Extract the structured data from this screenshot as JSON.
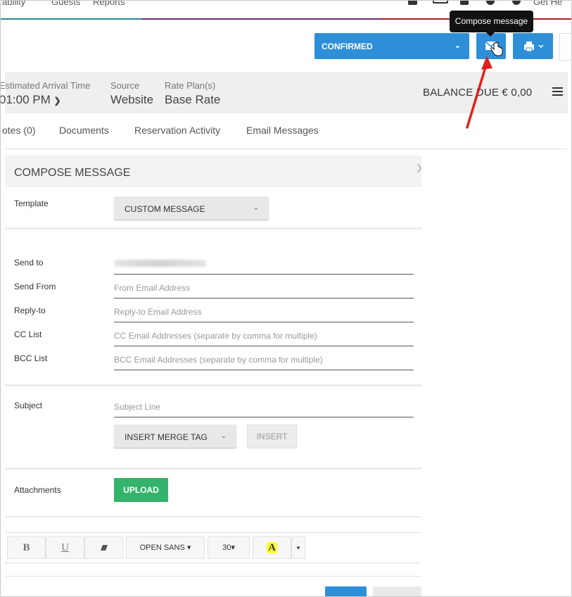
{
  "topnav": {
    "items": [
      "ability",
      "Guests",
      "Reports",
      "Get He"
    ]
  },
  "tooltip": {
    "text": "Compose message"
  },
  "actionbar": {
    "status_label": "CONFIRMED",
    "chevron": "⌄",
    "mail_icon": "envelope-icon",
    "print_icon": "printer-icon"
  },
  "info": {
    "arrival": {
      "label": "Estimated Arrival Time",
      "value": "01:00 PM"
    },
    "source": {
      "label": "Source",
      "value": "Website"
    },
    "rate": {
      "label": "Rate Plan(s)",
      "value": "Base Rate"
    },
    "balance": "BALANCE DUE € 0,00"
  },
  "tabs": [
    "otes (0)",
    "Documents",
    "Reservation Activity",
    "Email Messages"
  ],
  "compose": {
    "title": "COMPOSE MESSAGE",
    "template_label": "Template",
    "template_value": "CUSTOM MESSAGE",
    "send_to_label": "Send to",
    "send_from_label": "Send From",
    "send_from_placeholder": "From Email Address",
    "reply_to_label": "Reply-to",
    "reply_to_placeholder": "Reply-to Email Address",
    "cc_label": "CC List",
    "cc_placeholder": "CC Email Addresses (separate by comma for multiple)",
    "bcc_label": "BCC List",
    "bcc_placeholder": "BCC Email Addresses (separate by comma for multiple)",
    "subject_label": "Subject",
    "subject_placeholder": "Subject Line",
    "merge_tag_label": "INSERT MERGE TAG",
    "insert_label": "INSERT",
    "attachments_label": "Attachments",
    "upload_label": "UPLOAD"
  },
  "toolbar": {
    "bold": "B",
    "underline": "U",
    "font": "OPEN SANS ▾",
    "size": "30▾",
    "highlight": "A",
    "more": "▾"
  },
  "colors": {
    "primary": "#2e8fd8",
    "success": "#34b36a",
    "arrow": "#e0201b"
  }
}
